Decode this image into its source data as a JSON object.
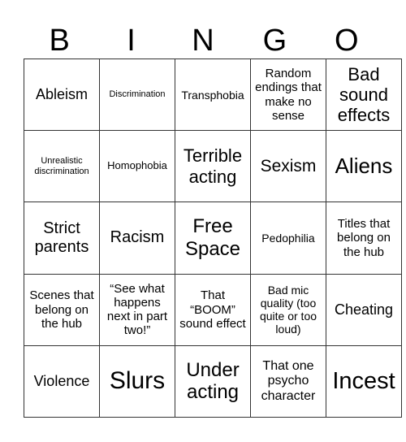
{
  "header": {
    "letters": [
      "B",
      "I",
      "N",
      "G",
      "O"
    ]
  },
  "card": {
    "rows": [
      [
        "Ableism",
        "Discrimination",
        "Transphobia",
        "Random endings that make no sense",
        "Bad sound effects"
      ],
      [
        "Unrealistic discrimination",
        "Homophobia",
        "Terrible acting",
        "Sexism",
        "Aliens"
      ],
      [
        "Strict parents",
        "Racism",
        "Free Space",
        "Pedophilia",
        "Titles that belong on the hub"
      ],
      [
        "Scenes that belong on the hub",
        "“See what happens next in part two!”",
        "That “BOOM” sound effect",
        "Bad mic quality (too quite or too loud)",
        "Cheating"
      ],
      [
        "Violence",
        "Slurs",
        "Under acting",
        "That one psycho character",
        "Incest"
      ]
    ]
  },
  "colors": {
    "grid_line": "#333333",
    "background": "#ffffff",
    "text": "#000000"
  }
}
